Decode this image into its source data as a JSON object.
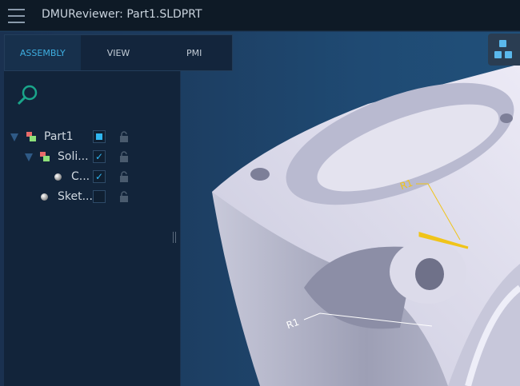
{
  "app": {
    "title": "DMUReviewer:  Part1.SLDPRT"
  },
  "tabs": [
    {
      "label": "ASSEMBLY",
      "active": true
    },
    {
      "label": "VIEW"
    },
    {
      "label": "PMI"
    }
  ],
  "tree": [
    {
      "label": "Part1",
      "state": "partial",
      "expanded": true
    },
    {
      "label": "Soli...",
      "state": "checked",
      "expanded": true
    },
    {
      "label": "C...",
      "state": "checked"
    },
    {
      "label": "Sket...",
      "state": "unchecked"
    }
  ],
  "annotations": [
    {
      "label": "R1",
      "color": "#f0c419"
    },
    {
      "label": "R1",
      "color": "#ffffff"
    }
  ],
  "colors": {
    "accent": "#3eaee0",
    "highlight": "#f0c419"
  }
}
